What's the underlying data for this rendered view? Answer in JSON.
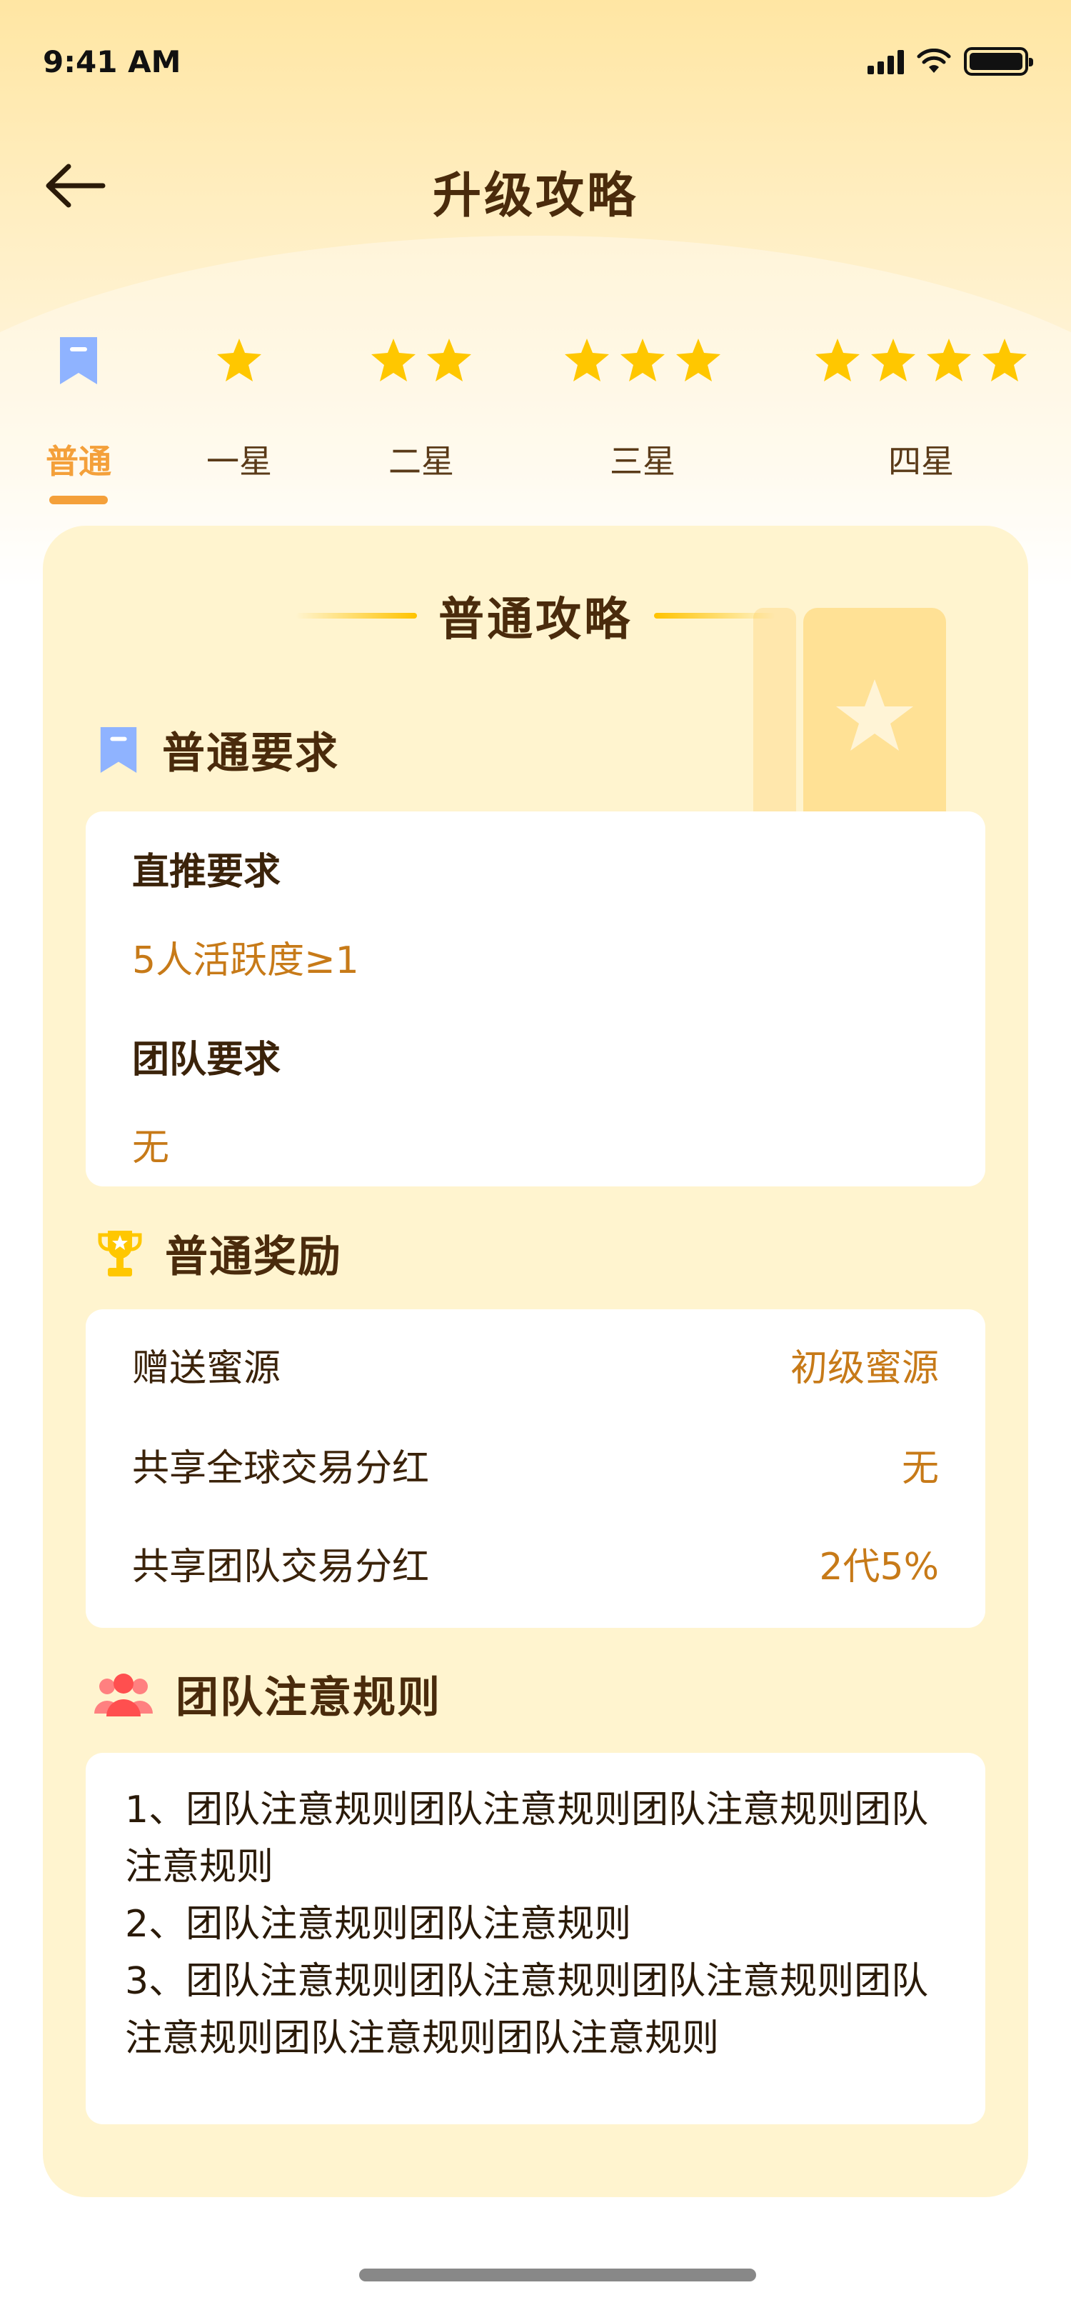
{
  "status_bar": {
    "time": "9:41 AM"
  },
  "nav": {
    "title": "升级攻略"
  },
  "tabs": [
    {
      "label": "普通",
      "stars": 0,
      "active": true
    },
    {
      "label": "一星",
      "stars": 1,
      "active": false
    },
    {
      "label": "二星",
      "stars": 2,
      "active": false
    },
    {
      "label": "三星",
      "stars": 3,
      "active": false
    },
    {
      "label": "四星",
      "stars": 4,
      "active": false
    }
  ],
  "card": {
    "title": "普通攻略",
    "requirements": {
      "heading": "普通要求",
      "direct_label": "直推要求",
      "direct_value": "5人活跃度≥1",
      "team_label": "团队要求",
      "team_value": "无"
    },
    "rewards": {
      "heading": "普通奖励",
      "rows": [
        {
          "name": "赠送蜜源",
          "value": "初级蜜源"
        },
        {
          "name": "共享全球交易分红",
          "value": "无"
        },
        {
          "name": "共享团队交易分红",
          "value": "2代5%"
        }
      ]
    },
    "rules": {
      "heading": "团队注意规则",
      "lines": [
        " 1、团队注意规则团队注意规则团队注意规则团队注意规则",
        "2、团队注意规则团队注意规则",
        "3、团队注意规则团队注意规则团队注意规则团队注意规则团队注意规则团队注意规则"
      ]
    }
  },
  "colors": {
    "accent": "#f4a03a",
    "star": "#ffc700",
    "value_text": "#c77a18",
    "card_bg": "#fff4cf",
    "bookmark_blue": "#8fb3ff",
    "rules_icon": "#ff5a5a"
  },
  "icons": {
    "back": "arrow-left-icon",
    "tab_normal": "bookmark-icon",
    "tab_star": "star-icon",
    "requirements": "bookmark-icon",
    "rewards": "trophy-icon",
    "rules": "group-icon"
  }
}
